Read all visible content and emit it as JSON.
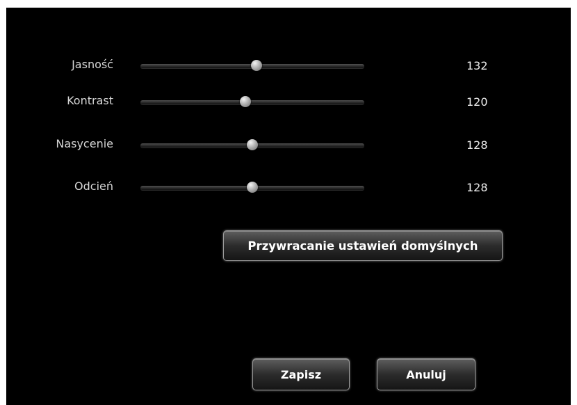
{
  "sliders": [
    {
      "label": "Jasność",
      "value": "132",
      "level": 0.52
    },
    {
      "label": "Kontrast",
      "value": "120",
      "level": 0.47
    },
    {
      "label": "Nasycenie",
      "value": "128",
      "level": 0.5
    },
    {
      "label": "Odcień",
      "value": "128",
      "level": 0.5
    }
  ],
  "restore_defaults_label": "Przywracanie ustawień domyślnych",
  "save_label": "Zapisz",
  "cancel_label": "Anuluj",
  "colors": {
    "background": "#000000",
    "text": "#d6d6d6"
  }
}
